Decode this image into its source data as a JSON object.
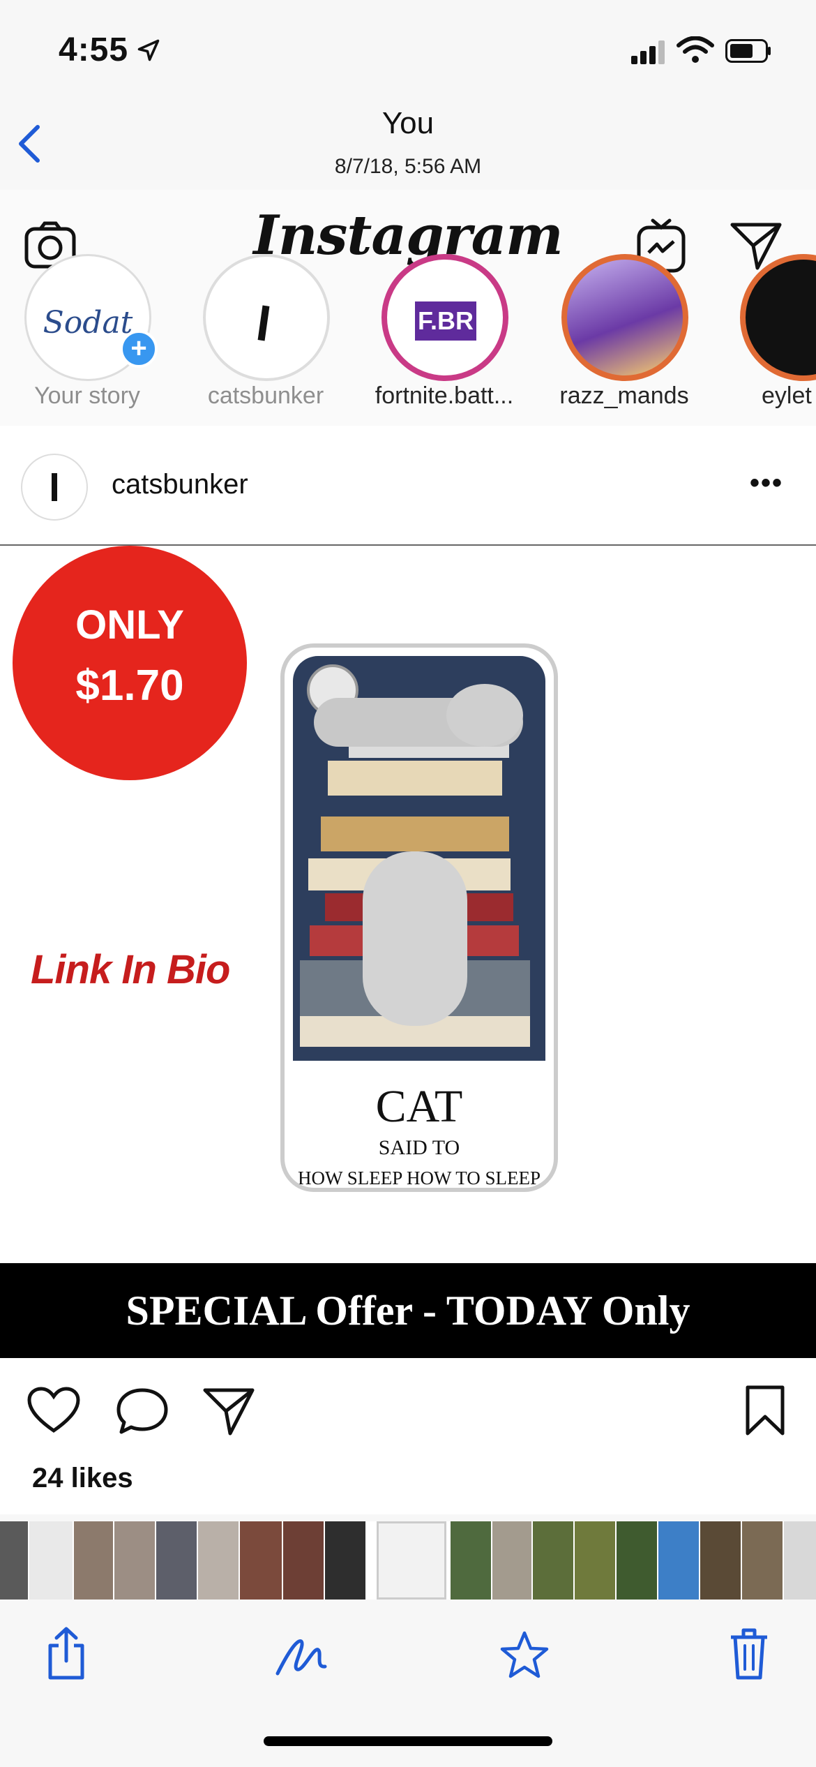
{
  "status": {
    "time": "4:55"
  },
  "photo_header": {
    "title": "You",
    "date": "8/7/18, 5:56 AM"
  },
  "instagram": {
    "logo": "Instagram",
    "stories": [
      {
        "label": "Your story",
        "inner_text": "Sodat"
      },
      {
        "label": "catsbunker"
      },
      {
        "label": "fortnite.batt...",
        "inner_text": "F.BR"
      },
      {
        "label": "razz_mands"
      },
      {
        "label": "eylet"
      }
    ],
    "post": {
      "username": "catsbunker",
      "more": "•••",
      "badge_line1": "ONLY",
      "badge_line2": "$1.70",
      "link_text": "Link In Bio",
      "case_title": "CAT",
      "case_line2": "SAID TO",
      "case_line3": "HOW SLEEP HOW TO SLEEP",
      "banner": "SPECIAL Offer - TODAY Only",
      "likes": "24 likes"
    }
  },
  "colors": {
    "accent": "#1f5bd6",
    "badge": "#e5251d",
    "link": "#c61d1d"
  }
}
